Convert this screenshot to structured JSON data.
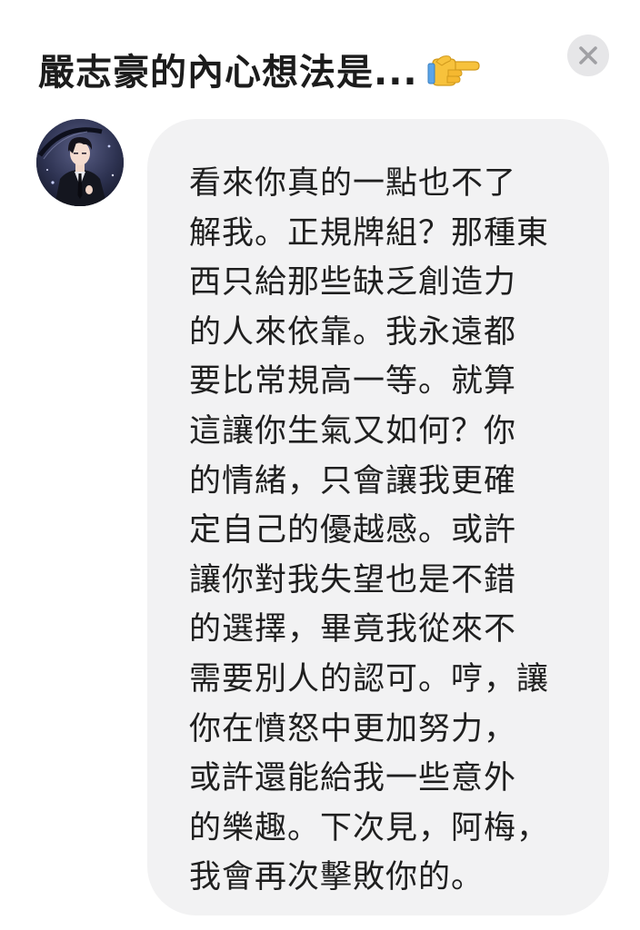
{
  "header": {
    "title": "嚴志豪的內心想法是...",
    "pointing_icon": "backhand-index-pointing-right-icon"
  },
  "close_button": {
    "icon": "close-icon"
  },
  "avatar": {
    "description": "character-portrait"
  },
  "message": {
    "text": "看來你真的一點也不了\n解我。正規牌組？那種東\n西只給那些缺乏創造力\n的人來依靠。我永遠都\n要比常規高一等。就算\n這讓你生氣又如何？你\n的情緒，只會讓我更確\n定自己的優越感。或許\n讓你對我失望也是不錯\n的選擇，畢竟我從來不\n需要別人的認可。哼，讓\n你在憤怒中更加努力，\n或許還能給我一些意外\n的樂趣。下次見，阿梅，\n我會再次擊敗你的。"
  },
  "colors": {
    "bubble_bg": "#f2f2f3",
    "close_bg": "#e6e6e8",
    "close_icon": "#a0a0a4",
    "text": "#1f1f1f"
  }
}
